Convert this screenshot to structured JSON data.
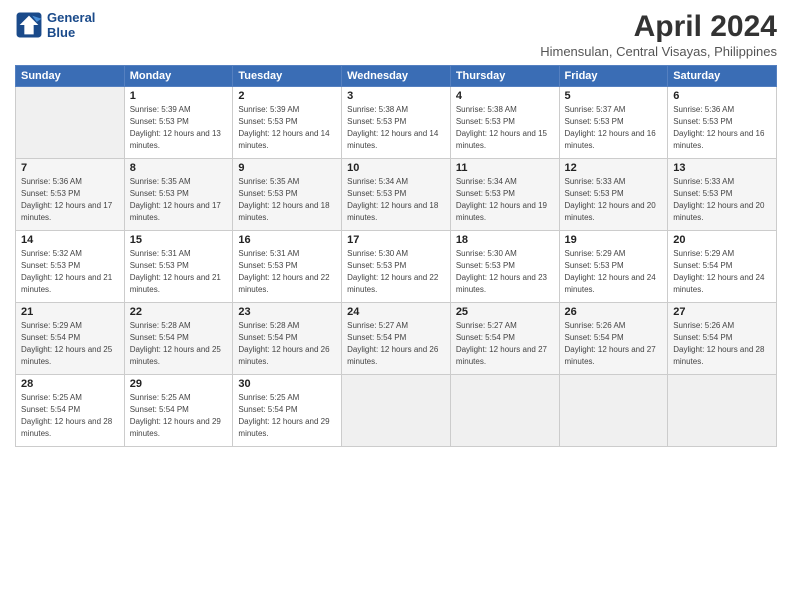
{
  "header": {
    "logo_line1": "General",
    "logo_line2": "Blue",
    "title": "April 2024",
    "subtitle": "Himensulan, Central Visayas, Philippines"
  },
  "weekdays": [
    "Sunday",
    "Monday",
    "Tuesday",
    "Wednesday",
    "Thursday",
    "Friday",
    "Saturday"
  ],
  "weeks": [
    [
      {
        "day": "",
        "sunrise": "",
        "sunset": "",
        "daylight": ""
      },
      {
        "day": "1",
        "sunrise": "Sunrise: 5:39 AM",
        "sunset": "Sunset: 5:53 PM",
        "daylight": "Daylight: 12 hours and 13 minutes."
      },
      {
        "day": "2",
        "sunrise": "Sunrise: 5:39 AM",
        "sunset": "Sunset: 5:53 PM",
        "daylight": "Daylight: 12 hours and 14 minutes."
      },
      {
        "day": "3",
        "sunrise": "Sunrise: 5:38 AM",
        "sunset": "Sunset: 5:53 PM",
        "daylight": "Daylight: 12 hours and 14 minutes."
      },
      {
        "day": "4",
        "sunrise": "Sunrise: 5:38 AM",
        "sunset": "Sunset: 5:53 PM",
        "daylight": "Daylight: 12 hours and 15 minutes."
      },
      {
        "day": "5",
        "sunrise": "Sunrise: 5:37 AM",
        "sunset": "Sunset: 5:53 PM",
        "daylight": "Daylight: 12 hours and 16 minutes."
      },
      {
        "day": "6",
        "sunrise": "Sunrise: 5:36 AM",
        "sunset": "Sunset: 5:53 PM",
        "daylight": "Daylight: 12 hours and 16 minutes."
      }
    ],
    [
      {
        "day": "7",
        "sunrise": "Sunrise: 5:36 AM",
        "sunset": "Sunset: 5:53 PM",
        "daylight": "Daylight: 12 hours and 17 minutes."
      },
      {
        "day": "8",
        "sunrise": "Sunrise: 5:35 AM",
        "sunset": "Sunset: 5:53 PM",
        "daylight": "Daylight: 12 hours and 17 minutes."
      },
      {
        "day": "9",
        "sunrise": "Sunrise: 5:35 AM",
        "sunset": "Sunset: 5:53 PM",
        "daylight": "Daylight: 12 hours and 18 minutes."
      },
      {
        "day": "10",
        "sunrise": "Sunrise: 5:34 AM",
        "sunset": "Sunset: 5:53 PM",
        "daylight": "Daylight: 12 hours and 18 minutes."
      },
      {
        "day": "11",
        "sunrise": "Sunrise: 5:34 AM",
        "sunset": "Sunset: 5:53 PM",
        "daylight": "Daylight: 12 hours and 19 minutes."
      },
      {
        "day": "12",
        "sunrise": "Sunrise: 5:33 AM",
        "sunset": "Sunset: 5:53 PM",
        "daylight": "Daylight: 12 hours and 20 minutes."
      },
      {
        "day": "13",
        "sunrise": "Sunrise: 5:33 AM",
        "sunset": "Sunset: 5:53 PM",
        "daylight": "Daylight: 12 hours and 20 minutes."
      }
    ],
    [
      {
        "day": "14",
        "sunrise": "Sunrise: 5:32 AM",
        "sunset": "Sunset: 5:53 PM",
        "daylight": "Daylight: 12 hours and 21 minutes."
      },
      {
        "day": "15",
        "sunrise": "Sunrise: 5:31 AM",
        "sunset": "Sunset: 5:53 PM",
        "daylight": "Daylight: 12 hours and 21 minutes."
      },
      {
        "day": "16",
        "sunrise": "Sunrise: 5:31 AM",
        "sunset": "Sunset: 5:53 PM",
        "daylight": "Daylight: 12 hours and 22 minutes."
      },
      {
        "day": "17",
        "sunrise": "Sunrise: 5:30 AM",
        "sunset": "Sunset: 5:53 PM",
        "daylight": "Daylight: 12 hours and 22 minutes."
      },
      {
        "day": "18",
        "sunrise": "Sunrise: 5:30 AM",
        "sunset": "Sunset: 5:53 PM",
        "daylight": "Daylight: 12 hours and 23 minutes."
      },
      {
        "day": "19",
        "sunrise": "Sunrise: 5:29 AM",
        "sunset": "Sunset: 5:53 PM",
        "daylight": "Daylight: 12 hours and 24 minutes."
      },
      {
        "day": "20",
        "sunrise": "Sunrise: 5:29 AM",
        "sunset": "Sunset: 5:54 PM",
        "daylight": "Daylight: 12 hours and 24 minutes."
      }
    ],
    [
      {
        "day": "21",
        "sunrise": "Sunrise: 5:29 AM",
        "sunset": "Sunset: 5:54 PM",
        "daylight": "Daylight: 12 hours and 25 minutes."
      },
      {
        "day": "22",
        "sunrise": "Sunrise: 5:28 AM",
        "sunset": "Sunset: 5:54 PM",
        "daylight": "Daylight: 12 hours and 25 minutes."
      },
      {
        "day": "23",
        "sunrise": "Sunrise: 5:28 AM",
        "sunset": "Sunset: 5:54 PM",
        "daylight": "Daylight: 12 hours and 26 minutes."
      },
      {
        "day": "24",
        "sunrise": "Sunrise: 5:27 AM",
        "sunset": "Sunset: 5:54 PM",
        "daylight": "Daylight: 12 hours and 26 minutes."
      },
      {
        "day": "25",
        "sunrise": "Sunrise: 5:27 AM",
        "sunset": "Sunset: 5:54 PM",
        "daylight": "Daylight: 12 hours and 27 minutes."
      },
      {
        "day": "26",
        "sunrise": "Sunrise: 5:26 AM",
        "sunset": "Sunset: 5:54 PM",
        "daylight": "Daylight: 12 hours and 27 minutes."
      },
      {
        "day": "27",
        "sunrise": "Sunrise: 5:26 AM",
        "sunset": "Sunset: 5:54 PM",
        "daylight": "Daylight: 12 hours and 28 minutes."
      }
    ],
    [
      {
        "day": "28",
        "sunrise": "Sunrise: 5:25 AM",
        "sunset": "Sunset: 5:54 PM",
        "daylight": "Daylight: 12 hours and 28 minutes."
      },
      {
        "day": "29",
        "sunrise": "Sunrise: 5:25 AM",
        "sunset": "Sunset: 5:54 PM",
        "daylight": "Daylight: 12 hours and 29 minutes."
      },
      {
        "day": "30",
        "sunrise": "Sunrise: 5:25 AM",
        "sunset": "Sunset: 5:54 PM",
        "daylight": "Daylight: 12 hours and 29 minutes."
      },
      {
        "day": "",
        "sunrise": "",
        "sunset": "",
        "daylight": ""
      },
      {
        "day": "",
        "sunrise": "",
        "sunset": "",
        "daylight": ""
      },
      {
        "day": "",
        "sunrise": "",
        "sunset": "",
        "daylight": ""
      },
      {
        "day": "",
        "sunrise": "",
        "sunset": "",
        "daylight": ""
      }
    ]
  ]
}
